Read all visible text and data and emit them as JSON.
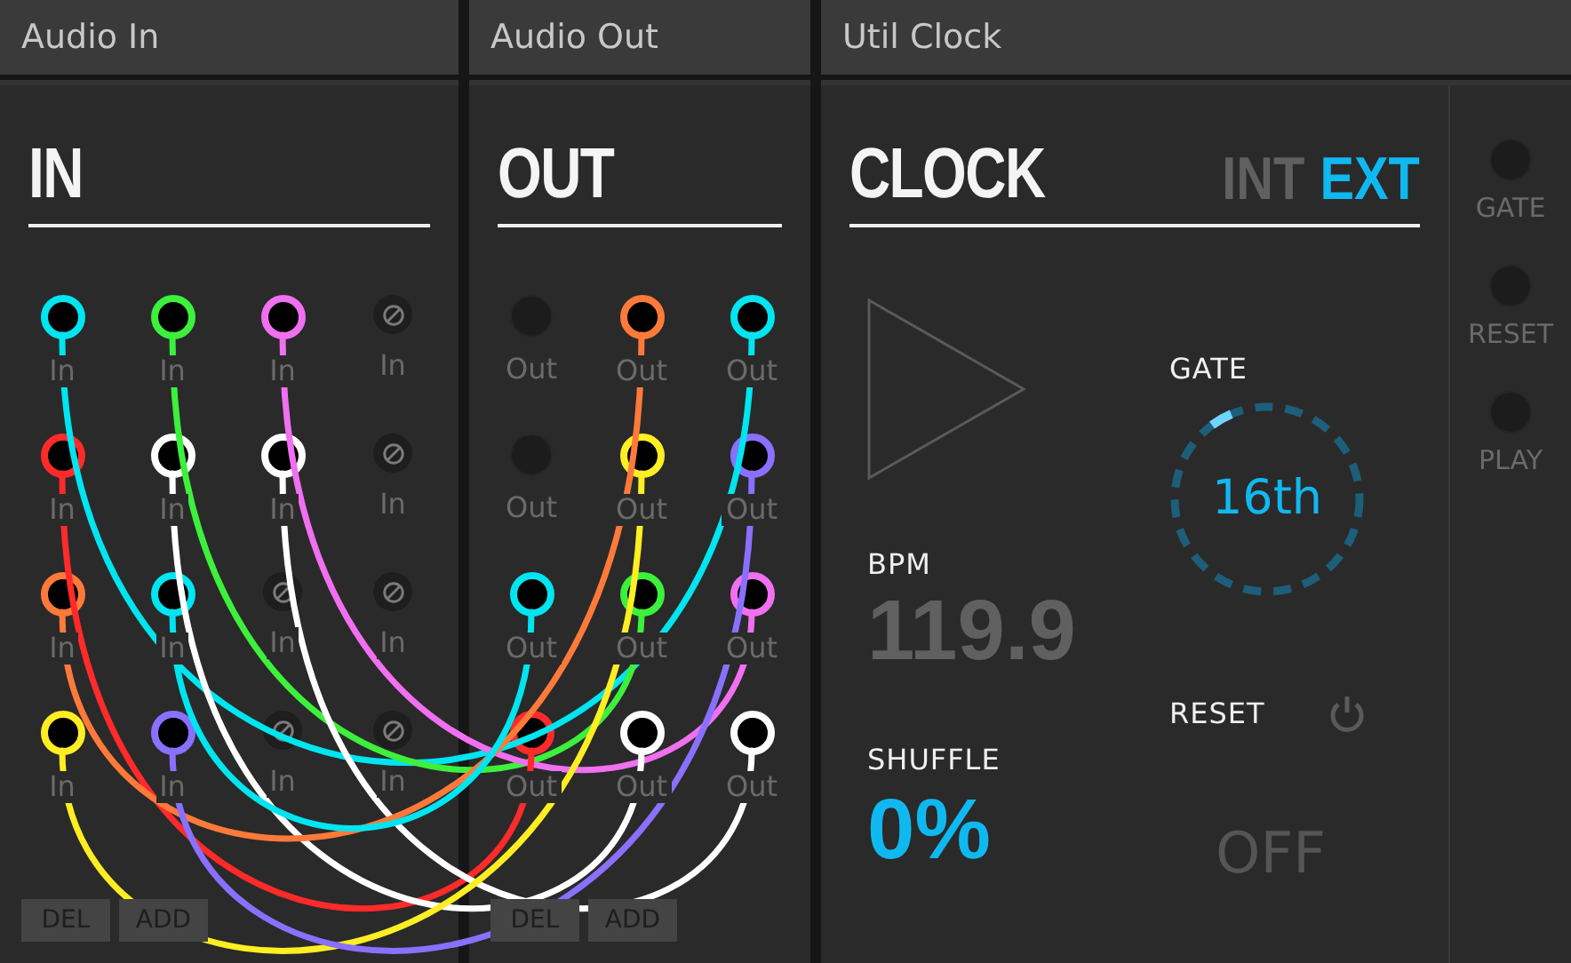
{
  "audio_in": {
    "title": "Audio In",
    "heading": "IN",
    "jacks": [
      {
        "label": "In",
        "kind": "plug",
        "color": "#00e5f0"
      },
      {
        "label": "In",
        "kind": "plug",
        "color": "#3cf03c"
      },
      {
        "label": "In",
        "kind": "plug",
        "color": "#f070f0"
      },
      {
        "label": "In",
        "kind": "disabled"
      },
      {
        "label": "In",
        "kind": "plug",
        "color": "#ff2a2a"
      },
      {
        "label": "In",
        "kind": "plug",
        "color": "#ffffff"
      },
      {
        "label": "In",
        "kind": "plug",
        "color": "#ffffff"
      },
      {
        "label": "In",
        "kind": "disabled"
      },
      {
        "label": "In",
        "kind": "plug",
        "color": "#ff7a3a"
      },
      {
        "label": "In",
        "kind": "plug",
        "color": "#00e5f0"
      },
      {
        "label": "In",
        "kind": "disabled"
      },
      {
        "label": "In",
        "kind": "disabled"
      },
      {
        "label": "In",
        "kind": "plug",
        "color": "#ffee22"
      },
      {
        "label": "In",
        "kind": "plug",
        "color": "#8a70ff"
      },
      {
        "label": "In",
        "kind": "disabled"
      },
      {
        "label": "In",
        "kind": "disabled"
      }
    ],
    "buttons": [
      "DEL",
      "ADD"
    ]
  },
  "audio_out": {
    "title": "Audio Out",
    "heading": "OUT",
    "jacks": [
      {
        "label": "Out",
        "kind": "empty"
      },
      {
        "label": "Out",
        "kind": "plug",
        "color": "#ff7a3a"
      },
      {
        "label": "Out",
        "kind": "plug",
        "color": "#00e5f0"
      },
      {
        "label": "Out",
        "kind": "empty"
      },
      {
        "label": "Out",
        "kind": "plug",
        "color": "#ffee22"
      },
      {
        "label": "Out",
        "kind": "plug",
        "color": "#8a70ff"
      },
      {
        "label": "Out",
        "kind": "plug",
        "color": "#00e5f0"
      },
      {
        "label": "Out",
        "kind": "plug",
        "color": "#3cf03c"
      },
      {
        "label": "Out",
        "kind": "plug",
        "color": "#f070f0"
      },
      {
        "label": "Out",
        "kind": "plug",
        "color": "#ff2a2a"
      },
      {
        "label": "Out",
        "kind": "plug",
        "color": "#ffffff"
      },
      {
        "label": "Out",
        "kind": "plug",
        "color": "#ffffff"
      }
    ],
    "buttons": [
      "DEL",
      "ADD"
    ]
  },
  "clock": {
    "title": "Util Clock",
    "heading": "CLOCK",
    "sources": [
      {
        "label": "INT",
        "selected": false
      },
      {
        "label": "EXT",
        "selected": true
      }
    ],
    "bpm": {
      "label": "BPM",
      "value": "119.9"
    },
    "shuffle": {
      "label": "SHUFFLE",
      "value": "0%"
    },
    "gate": {
      "label": "GATE",
      "value": "16th"
    },
    "reset": {
      "label": "RESET",
      "value": "OFF",
      "on": false
    },
    "outputs": [
      {
        "label": "GATE"
      },
      {
        "label": "RESET"
      },
      {
        "label": "PLAY"
      }
    ]
  }
}
